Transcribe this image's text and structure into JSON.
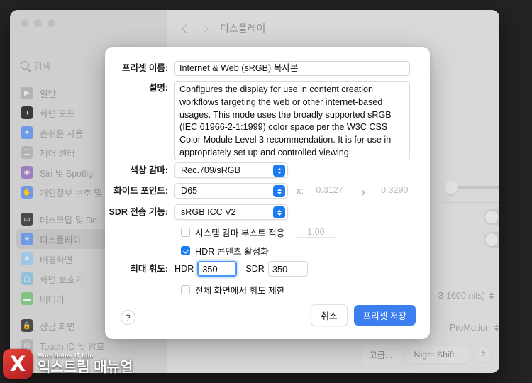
{
  "window": {
    "toolbar_title": "디스플레이",
    "back_icon": "chevron-left-icon",
    "forward_icon": "chevron-right-icon"
  },
  "sidebar": {
    "search_placeholder": "검색",
    "items": [
      {
        "label": "일반",
        "icon": "gear-icon",
        "color": "#b3b3b3",
        "glyph": "▶",
        "selected": false
      },
      {
        "label": "화면 모드",
        "icon": "appearance-icon",
        "color": "#3a3a3a",
        "glyph": "◑",
        "selected": false
      },
      {
        "label": "손쉬운 사용",
        "icon": "accessibility-icon",
        "color": "#6f9ae8",
        "glyph": "✦",
        "selected": false
      },
      {
        "label": "제어 센터",
        "icon": "control-center-icon",
        "color": "#b3b3b3",
        "glyph": "☰",
        "selected": false
      },
      {
        "label": "Siri 및 Spotlig",
        "icon": "siri-icon",
        "color": "#9d7fc0",
        "glyph": "◉",
        "selected": false
      },
      {
        "label": "개인정보 보호 및",
        "icon": "privacy-icon",
        "color": "#6f9ae8",
        "glyph": "✋",
        "selected": false
      }
    ],
    "items2": [
      {
        "label": "데스크탑 및 Do",
        "icon": "desktop-dock-icon",
        "color": "#4a4a4a",
        "glyph": "▭",
        "selected": false
      },
      {
        "label": "디스플레이",
        "icon": "display-icon",
        "color": "#6f9ae8",
        "glyph": "☀",
        "selected": true
      },
      {
        "label": "배경화면",
        "icon": "wallpaper-icon",
        "color": "#9ec6e6",
        "glyph": "❄",
        "selected": false
      },
      {
        "label": "화면 보호기",
        "icon": "screensaver-icon",
        "color": "#8fc0d8",
        "glyph": "▢",
        "selected": false
      },
      {
        "label": "배터리",
        "icon": "battery-icon",
        "color": "#84c285",
        "glyph": "▬",
        "selected": false
      }
    ],
    "items3": [
      {
        "label": "잠금 화면",
        "icon": "lock-screen-icon",
        "color": "#4a4a4a",
        "glyph": "🔒",
        "selected": false
      },
      {
        "label": "Touch ID 및 암호",
        "icon": "touch-id-icon",
        "color": "#b3b3b3",
        "glyph": "◎",
        "selected": false
      }
    ]
  },
  "right_panel": {
    "brightness_slider_label": "brightness-slider",
    "hdr_range_popup": "3-1600 nits)",
    "refresh_popup": "ProMotion",
    "advanced_button": "고급...",
    "night_shift_button": "Night Shift...",
    "help_button": "?"
  },
  "sheet": {
    "name_label": "프리셋 이름:",
    "name_value": "Internet & Web (sRGB) 복사본",
    "desc_label": "설명:",
    "desc_value": "Configures the display for use in content creation workflows targeting the web or other internet-based usages. This mode uses the broadly supported sRGB (IEC 61966-2-1:1999) color space per the W3C CSS Color Module Level 3 recommendation. It is for use in appropriately set up and controlled viewing",
    "gamma_label": "색상 감마:",
    "gamma_value": "Rec.709/sRGB",
    "whitepoint_label": "화이트 포인트:",
    "whitepoint_value": "D65",
    "x_label": "x:",
    "x_value": "0.3127",
    "y_label": "y:",
    "y_value": "0.3290",
    "sdr_transfer_label": "SDR 전송 기능:",
    "sdr_transfer_value": "sRGB ICC V2",
    "gamma_boost_label": "시스템 감마 부스트 적용",
    "gamma_boost_checked": false,
    "gamma_boost_value": "1.00",
    "hdr_content_label": "HDR 콘텐츠 활성화",
    "hdr_content_checked": true,
    "max_lum_label": "최대 휘도:",
    "hdr_sub_label": "HDR",
    "hdr_sub_value": "350",
    "sdr_sub_label": "SDR",
    "sdr_sub_value": "350",
    "fullscreen_limit_label": "전체 화면에서 휘도 제한",
    "fullscreen_limit_checked": false,
    "help_label": "?",
    "cancel_label": "취소",
    "save_label": "프리셋 저장",
    "accent_color": "#3b7ef0"
  },
  "watermark": {
    "logo_glyph": "X",
    "tagline": "More Better IT Life",
    "title": "익스트림 매뉴얼"
  }
}
